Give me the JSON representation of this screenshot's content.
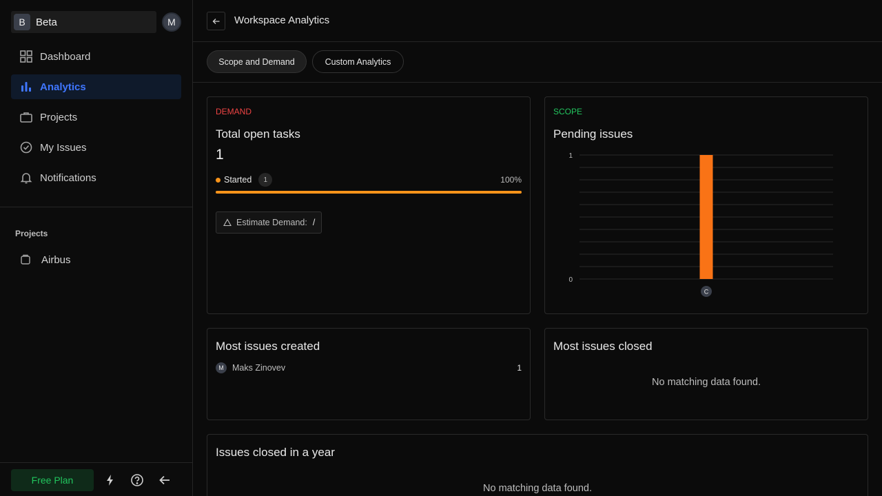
{
  "workspace": {
    "initial": "B",
    "name": "Beta"
  },
  "user": {
    "initial": "M"
  },
  "nav": [
    {
      "label": "Dashboard",
      "icon": "grid-icon"
    },
    {
      "label": "Analytics",
      "icon": "bar-chart-icon",
      "active": true
    },
    {
      "label": "Projects",
      "icon": "briefcase-icon"
    },
    {
      "label": "My Issues",
      "icon": "check-circle-icon"
    },
    {
      "label": "Notifications",
      "icon": "bell-icon"
    }
  ],
  "projects_section": {
    "title": "Projects",
    "items": [
      {
        "label": "Airbus",
        "icon": "project-icon"
      }
    ]
  },
  "footer": {
    "plan_label": "Free Plan"
  },
  "header": {
    "title": "Workspace Analytics"
  },
  "tabs": [
    {
      "label": "Scope and Demand",
      "active": true
    },
    {
      "label": "Custom Analytics",
      "active": false
    }
  ],
  "demand_card": {
    "eyebrow": "DEMAND",
    "title": "Total open tasks",
    "total": "1",
    "state_label": "Started",
    "state_count": "1",
    "state_percent": "100%",
    "progress": 1.0,
    "estimate_label": "Estimate Demand:",
    "estimate_value": "/"
  },
  "scope_card": {
    "eyebrow": "SCOPE",
    "title": "Pending issues"
  },
  "chart_data": {
    "type": "bar",
    "categories": [
      "C"
    ],
    "values": [
      1
    ],
    "ylim": [
      0,
      1
    ],
    "y_ticks": [
      "0",
      "1"
    ],
    "grid": true,
    "bar_color": "#f97316"
  },
  "created_card": {
    "title": "Most issues created",
    "rows": [
      {
        "initial": "M",
        "name": "Maks Zinovev",
        "count": "1"
      }
    ]
  },
  "closed_card": {
    "title": "Most issues closed",
    "empty": "No matching data found."
  },
  "year_card": {
    "title": "Issues closed in a year",
    "empty": "No matching data found."
  },
  "colors": {
    "accent": "#3f76ff",
    "demand": "#ef4444",
    "scope": "#22c55e",
    "started": "#f7931a"
  }
}
